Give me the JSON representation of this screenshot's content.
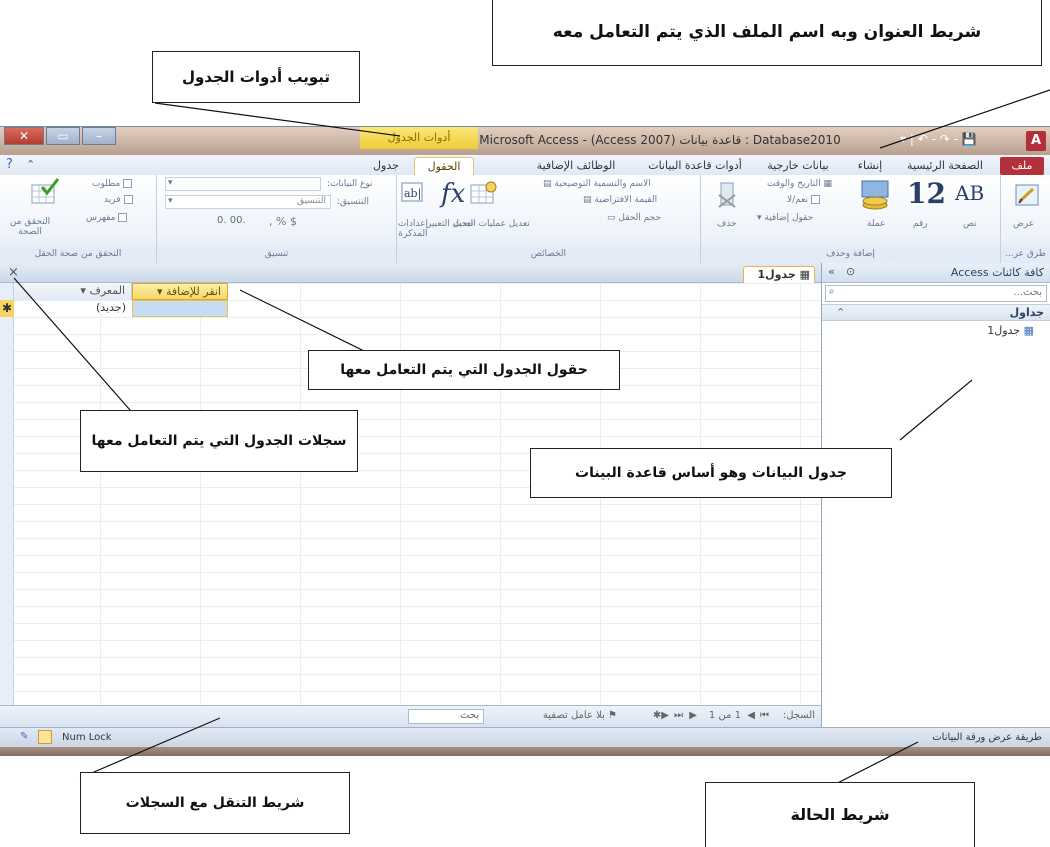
{
  "annotations": {
    "title_bar": "شريط العنوان وبه اسم الملف الذي يتم التعامل معه",
    "table_tools_tab": "تبويب أدوات الجدول",
    "table_fields": "حقول الجدول التي يتم التعامل معها",
    "table_records": "سجلات الجدول التي يتم التعامل معها",
    "data_table": "جدول البيانات وهو أساس قاعدة البينات",
    "record_nav_bar": "شريط التنقل مع السجلات",
    "status_bar": "شريط الحالة"
  },
  "window": {
    "title": "Microsoft Access - (Access 2007) قاعدة بيانات : Database2010",
    "contextual_tab": "أدوات الجدول",
    "app_icon": "A",
    "controls": {
      "close": "✕",
      "restore": "▭",
      "minimize": "–"
    },
    "qat": "▾ | ↶ - ↷ - 💾"
  },
  "tabs": [
    {
      "label": "ملف",
      "key": "file"
    },
    {
      "label": "الصفحة الرئيسية",
      "key": "home"
    },
    {
      "label": "إنشاء",
      "key": "create"
    },
    {
      "label": "بيانات خارجية",
      "key": "external"
    },
    {
      "label": "أدوات قاعدة البيانات",
      "key": "dbtools"
    },
    {
      "label": "الوظائف الإضافية",
      "key": "addins"
    },
    {
      "label": "الحقول",
      "key": "fields"
    },
    {
      "label": "جدول",
      "key": "table"
    }
  ],
  "ribbon": {
    "view_group": {
      "label": "طرق عر...",
      "button": "عرض"
    },
    "add_delete_group": {
      "label": "إضافة وحذف",
      "text": "نص",
      "number": "رقم",
      "currency": "عملة",
      "date_time": "التاريخ والوقت",
      "yes_no": "نعم/لا",
      "more_fields": "حقول إضافية",
      "delete": "حذف",
      "big_number": "12",
      "big_text": "AB"
    },
    "properties_group": {
      "label": "الخصائص",
      "name_caption": "الاسم والتسمية التوضيحية",
      "default_value": "القيمة الافتراضية",
      "field_size": "حجم الحقل",
      "modify_lookups": "تعديل عمليات البحث",
      "modify_expression": "تعديل التعبير",
      "memo_settings": "إعدادات المذكرة"
    },
    "formatting_group": {
      "label": "تنسيق",
      "data_type": "نوع البيانات:",
      "format": "التنسيق:",
      "format_value": "التنسيق",
      "currency_symbols": "$ % ,"
    },
    "validation_group": {
      "label": "التحقق من صحة الحقل",
      "required": "مطلوب",
      "unique": "فريد",
      "indexed": "مفهرس",
      "validation": "التحقق من الصحة"
    }
  },
  "nav_pane": {
    "header": "كافة كائنات Access",
    "search_placeholder": "بحث...",
    "group": "جداول",
    "items": [
      "جدول1"
    ]
  },
  "document": {
    "tab_label": "جدول1",
    "close": "×",
    "columns": [
      {
        "label": "المعرف"
      },
      {
        "label": "انقر للإضافة"
      }
    ],
    "new_record_marker": "✱",
    "new_record_text": "(جديد)"
  },
  "record_nav": {
    "label": "السجل:",
    "position": "1 من 1",
    "no_filter": "بلا عامل تصفية",
    "search": "بحث"
  },
  "status": {
    "left": "طريقة عرض ورقة البيانات",
    "num_lock": "Num Lock"
  }
}
